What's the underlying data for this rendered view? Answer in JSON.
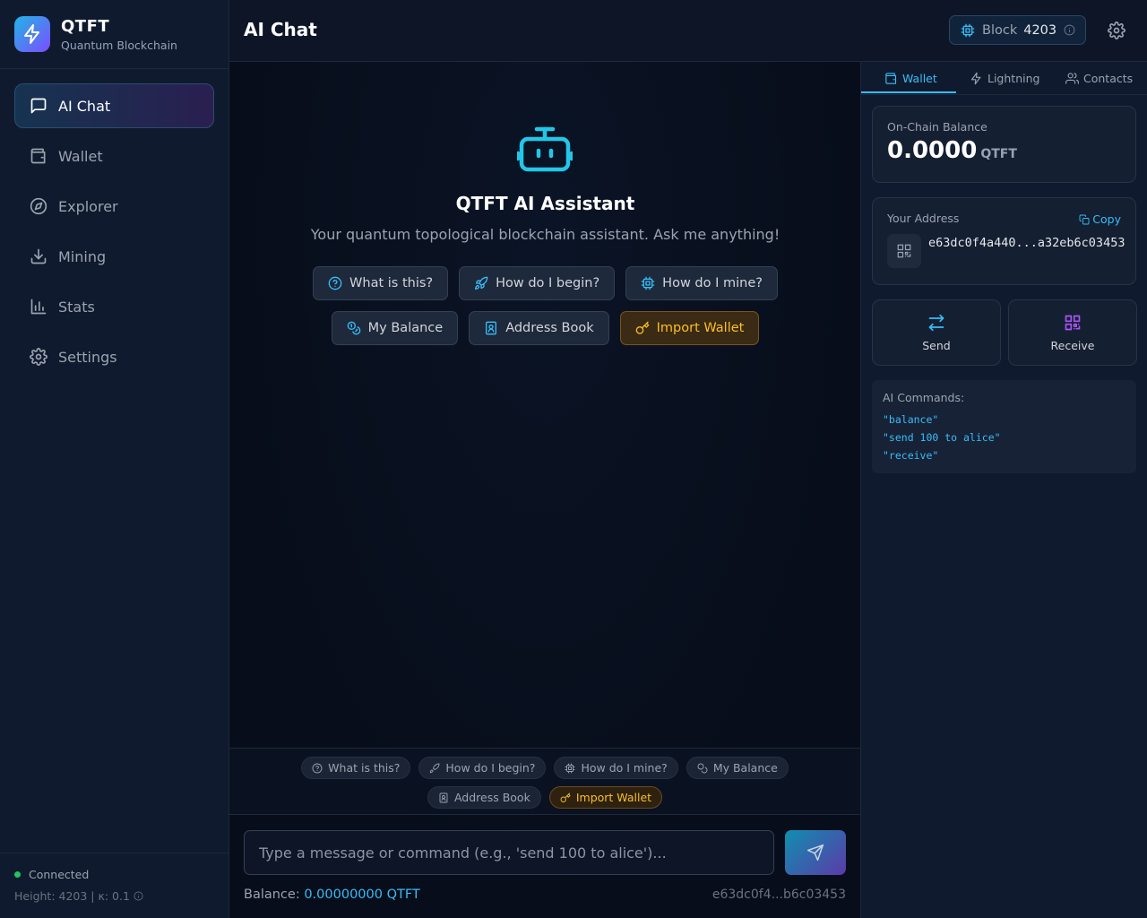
{
  "brand": {
    "name": "QTFT",
    "subtitle": "Quantum Blockchain"
  },
  "nav": [
    {
      "label": "AI Chat",
      "icon": "message-square-icon",
      "active": true
    },
    {
      "label": "Wallet",
      "icon": "wallet-icon"
    },
    {
      "label": "Explorer",
      "icon": "compass-icon"
    },
    {
      "label": "Mining",
      "icon": "download-icon"
    },
    {
      "label": "Stats",
      "icon": "bar-chart-icon"
    },
    {
      "label": "Settings",
      "icon": "gear-icon"
    }
  ],
  "status": {
    "connection": "Connected",
    "height": "Height: 4203 | κ: 0.1"
  },
  "header": {
    "title": "AI Chat",
    "block_label": "Block",
    "block_number": "4203"
  },
  "welcome": {
    "title": "QTFT AI Assistant",
    "subtitle": "Your quantum topological blockchain assistant. Ask me anything!"
  },
  "suggestions": [
    {
      "label": "What is this?",
      "icon": "help-circle-icon"
    },
    {
      "label": "How do I begin?",
      "icon": "rocket-icon"
    },
    {
      "label": "How do I mine?",
      "icon": "cpu-icon"
    },
    {
      "label": "My Balance",
      "icon": "coins-icon"
    },
    {
      "label": "Address Book",
      "icon": "contact-book-icon"
    },
    {
      "label": "Import Wallet",
      "icon": "key-icon"
    }
  ],
  "composer": {
    "placeholder": "Type a message or command (e.g., 'send 100 to alice')...",
    "balance_label": "Balance:",
    "balance_value": "0.00000000 QTFT",
    "address_short": "e63dc0f4...b6c03453"
  },
  "panel": {
    "tabs": [
      "Wallet",
      "Lightning",
      "Contacts"
    ],
    "onchain_label": "On-Chain Balance",
    "onchain_value": "0.0000",
    "onchain_unit": "QTFT",
    "address_label": "Your Address",
    "copy_label": "Copy",
    "address_value": "e63dc0f4a440...a32eb6c03453",
    "send_label": "Send",
    "receive_label": "Receive",
    "commands_title": "AI Commands:",
    "commands": [
      "\"balance\"",
      "\"send 100 to alice\"",
      "\"receive\""
    ]
  },
  "colors": {
    "accent": "#38bdf8",
    "gold": "#fbbf24",
    "success": "#22c55e",
    "purple": "#a855f7"
  }
}
